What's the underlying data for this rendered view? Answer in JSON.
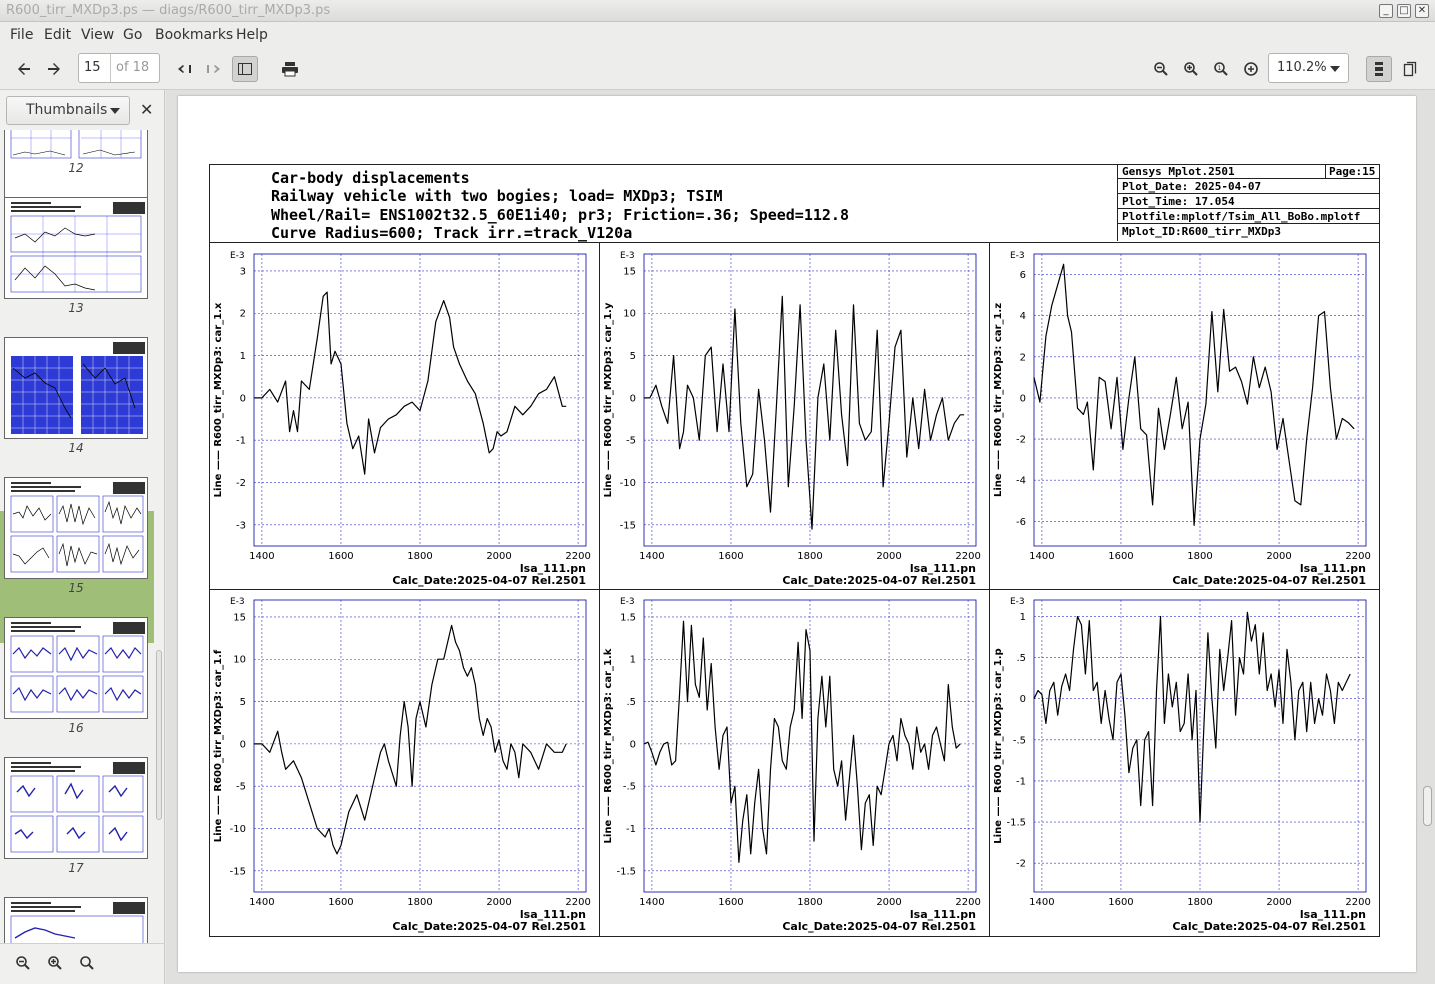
{
  "window": {
    "title": "R600_tirr_MXDp3.ps — diags/R600_tirr_MXDp3.ps"
  },
  "menu": [
    "File",
    "Edit",
    "View",
    "Go",
    "Bookmarks",
    "Help"
  ],
  "toolbar": {
    "page_current": "15",
    "page_total": "of 18",
    "zoom": "110.2%"
  },
  "sidebar": {
    "mode": "Thumbnails",
    "thumbnails": [
      "12",
      "13",
      "14",
      "15",
      "16",
      "17"
    ],
    "selected": "15"
  },
  "document": {
    "header_lines": [
      "Car-body displacements",
      "Railway vehicle with two bogies; load= MXDp3; TSIM",
      "Wheel/Rail= ENS1002t32.5_60E1i40; pr3; Friction=.36; Speed=112.8",
      "Curve Radius=600; Track irr.=track_V120a"
    ],
    "info": {
      "program": "Gensys Mplot.2501",
      "page": "Page:15",
      "plot_date": "Plot_Date: 2025-04-07",
      "plot_time": "Plot_Time: 17.054",
      "plotfile": "Plotfile:mplotf/Tsim_All_BoBo.mplotf",
      "mplot_id": "Mplot_ID:R600_tirr_MXDp3"
    },
    "panel_footer_1": "lsa_111.pn",
    "panel_footer_2": "Calc_Date:2025-04-07 Rel.2501"
  },
  "chart_data": [
    {
      "type": "line",
      "ylabel": "Line —— R600_tirr_MXDp3: car_1.x",
      "yscale_label": "E-3",
      "xlim": [
        1380,
        2220
      ],
      "ylim": [
        -3.5,
        3.4
      ],
      "xticks": [
        1400,
        1600,
        1800,
        2000,
        2200
      ],
      "yticks": [
        -3,
        -2,
        -1,
        0,
        1,
        2,
        3
      ],
      "ytick_labels": [
        "-3",
        "-2",
        "-1",
        "0",
        "1",
        "2",
        "3"
      ],
      "series": [
        {
          "x": [
            1380,
            1400,
            1420,
            1440,
            1460,
            1470,
            1480,
            1490,
            1500,
            1520,
            1540,
            1555,
            1565,
            1575,
            1585,
            1600,
            1615,
            1630,
            1645,
            1660,
            1670,
            1685,
            1700,
            1720,
            1740,
            1760,
            1780,
            1800,
            1820,
            1840,
            1860,
            1875,
            1885,
            1900,
            1920,
            1940,
            1960,
            1975,
            1985,
            1995,
            2005,
            2020,
            2040,
            2060,
            2080,
            2100,
            2120,
            2140,
            2160,
            2170
          ],
          "y": [
            0,
            0,
            0.2,
            -0.1,
            0.4,
            -0.8,
            -0.3,
            -0.8,
            0.4,
            0.2,
            1.4,
            2.4,
            2.5,
            0.8,
            1.1,
            0.8,
            -0.6,
            -1.2,
            -0.9,
            -1.8,
            -0.5,
            -1.3,
            -0.7,
            -0.5,
            -0.4,
            -0.2,
            -0.1,
            -0.3,
            0.4,
            1.8,
            2.3,
            1.9,
            1.2,
            0.8,
            0.4,
            0.1,
            -0.6,
            -1.3,
            -1.2,
            -0.8,
            -0.9,
            -0.8,
            -0.2,
            -0.4,
            -0.2,
            0.1,
            0.2,
            0.5,
            -0.2,
            -0.2
          ]
        }
      ]
    },
    {
      "type": "line",
      "ylabel": "Line —— R600_tirr_MXDp3: car_1.y",
      "yscale_label": "E-3",
      "xlim": [
        1380,
        2220
      ],
      "ylim": [
        -17.5,
        17
      ],
      "xticks": [
        1400,
        1600,
        1800,
        2000,
        2200
      ],
      "yticks": [
        -15,
        -10,
        -5,
        0,
        5,
        10,
        15
      ],
      "ytick_labels": [
        "-15",
        "-10",
        "-5",
        "0",
        "5",
        "10",
        "15"
      ],
      "series": [
        {
          "x": [
            1380,
            1395,
            1410,
            1425,
            1440,
            1455,
            1470,
            1480,
            1490,
            1505,
            1520,
            1535,
            1550,
            1565,
            1580,
            1595,
            1610,
            1625,
            1640,
            1655,
            1670,
            1685,
            1700,
            1715,
            1730,
            1745,
            1760,
            1775,
            1790,
            1805,
            1820,
            1835,
            1850,
            1865,
            1880,
            1895,
            1910,
            1925,
            1940,
            1955,
            1970,
            1985,
            2000,
            2015,
            2030,
            2045,
            2060,
            2075,
            2090,
            2105,
            2120,
            2135,
            2150,
            2165,
            2180,
            2190
          ],
          "y": [
            0,
            0,
            1.5,
            -1,
            -3,
            5,
            -6,
            -4,
            1.5,
            0,
            -5,
            5,
            6,
            -4,
            4,
            -4,
            10.5,
            -3,
            -10.5,
            -9,
            1,
            -5,
            -13.5,
            -1,
            12,
            -10.5,
            -1,
            11,
            -5,
            -15.5,
            0,
            4,
            -5,
            8,
            -2,
            -8,
            11,
            -3,
            -5,
            -4,
            8,
            -10.5,
            -3,
            6,
            8,
            -7,
            0,
            -6,
            1,
            -5,
            -2,
            0,
            -5,
            -3,
            -2,
            -2
          ]
        }
      ]
    },
    {
      "type": "line",
      "ylabel": "Line —— R600_tirr_MXDp3: car_1.z",
      "yscale_label": "E-3",
      "xlim": [
        1380,
        2220
      ],
      "ylim": [
        -7.2,
        7
      ],
      "xticks": [
        1400,
        1600,
        1800,
        2000,
        2200
      ],
      "yticks": [
        -6,
        -4,
        -2,
        0,
        2,
        4,
        6
      ],
      "ytick_labels": [
        "-6",
        "-4",
        "-2",
        "0",
        "2",
        "4",
        "6"
      ],
      "series": [
        {
          "x": [
            1380,
            1395,
            1410,
            1425,
            1440,
            1455,
            1465,
            1475,
            1490,
            1505,
            1515,
            1530,
            1545,
            1560,
            1575,
            1590,
            1605,
            1620,
            1635,
            1650,
            1665,
            1680,
            1695,
            1710,
            1725,
            1740,
            1755,
            1770,
            1785,
            1800,
            1815,
            1830,
            1845,
            1860,
            1875,
            1890,
            1905,
            1920,
            1935,
            1950,
            1965,
            1980,
            1995,
            2010,
            2025,
            2040,
            2055,
            2070,
            2085,
            2100,
            2115,
            2130,
            2145,
            2160,
            2175,
            2190
          ],
          "y": [
            1,
            -0.2,
            3,
            4.5,
            5.5,
            6.5,
            4,
            3.2,
            -0.5,
            -0.8,
            -0.2,
            -3.5,
            1,
            0.8,
            -1.5,
            1,
            -2.5,
            0,
            2,
            -1.5,
            -1.8,
            -5.2,
            -0.5,
            -2.5,
            -0.8,
            1,
            -1.5,
            -0.2,
            -6.2,
            -2,
            -0.3,
            4.2,
            0.3,
            4.3,
            1.3,
            1.5,
            0.8,
            -0.3,
            2,
            0.5,
            1.5,
            0.3,
            -2.5,
            -1,
            -3,
            -5,
            -5.2,
            -2,
            0.5,
            4,
            4.2,
            0.5,
            -2,
            -1,
            -1.2,
            -1.5
          ]
        }
      ]
    },
    {
      "type": "line",
      "ylabel": "Line —— R600_tirr_MXDp3: car_1.f",
      "yscale_label": "E-3",
      "xlim": [
        1380,
        2220
      ],
      "ylim": [
        -17.5,
        17
      ],
      "xticks": [
        1400,
        1600,
        1800,
        2000,
        2200
      ],
      "yticks": [
        -15,
        -10,
        -5,
        0,
        5,
        10,
        15
      ],
      "ytick_labels": [
        "-15",
        "-10",
        "-5",
        "0",
        "5",
        "10",
        "15"
      ],
      "series": [
        {
          "x": [
            1380,
            1400,
            1420,
            1440,
            1450,
            1460,
            1480,
            1500,
            1520,
            1540,
            1560,
            1570,
            1580,
            1590,
            1600,
            1610,
            1620,
            1640,
            1660,
            1680,
            1690,
            1700,
            1710,
            1720,
            1740,
            1750,
            1760,
            1770,
            1780,
            1790,
            1800,
            1815,
            1830,
            1845,
            1860,
            1875,
            1880,
            1890,
            1900,
            1910,
            1920,
            1930,
            1940,
            1950,
            1960,
            1970,
            1980,
            1990,
            2000,
            2010,
            2020,
            2030,
            2040,
            2050,
            2060,
            2080,
            2100,
            2120,
            2140,
            2160,
            2170
          ],
          "y": [
            0,
            0,
            -1,
            1.5,
            -1,
            -3,
            -2,
            -4,
            -7,
            -10,
            -11,
            -10,
            -12,
            -13,
            -12,
            -10,
            -8,
            -6,
            -9,
            -5,
            -3,
            -1,
            0,
            -2,
            -5,
            1,
            5,
            2,
            -5,
            3,
            5,
            2,
            7,
            10,
            10,
            13,
            14,
            12,
            11,
            9,
            8,
            9,
            7,
            3,
            1,
            3,
            2,
            -1,
            0.5,
            -2,
            -3,
            0,
            -1,
            -4,
            0,
            -1,
            -3,
            0,
            -1,
            -1,
            0
          ]
        }
      ]
    },
    {
      "type": "line",
      "ylabel": "Line —— R600_tirr_MXDp3: car_1.k",
      "yscale_label": "E-3",
      "xlim": [
        1380,
        2220
      ],
      "ylim": [
        -1.75,
        1.7
      ],
      "xticks": [
        1400,
        1600,
        1800,
        2000,
        2200
      ],
      "yticks": [
        -1.5,
        -1,
        -0.5,
        0,
        0.5,
        1,
        1.5
      ],
      "ytick_labels": [
        "-1.5",
        "-1",
        "-.5",
        "0",
        ".5",
        "1",
        "1.5"
      ],
      "series": [
        {
          "x": [
            1380,
            1390,
            1400,
            1410,
            1420,
            1430,
            1440,
            1450,
            1460,
            1470,
            1480,
            1490,
            1500,
            1510,
            1520,
            1530,
            1540,
            1550,
            1560,
            1570,
            1580,
            1590,
            1600,
            1610,
            1620,
            1630,
            1640,
            1650,
            1660,
            1670,
            1680,
            1690,
            1700,
            1710,
            1720,
            1730,
            1740,
            1750,
            1760,
            1770,
            1780,
            1790,
            1800,
            1810,
            1820,
            1830,
            1840,
            1850,
            1860,
            1870,
            1880,
            1890,
            1900,
            1910,
            1920,
            1930,
            1940,
            1950,
            1960,
            1970,
            1980,
            1990,
            2000,
            2010,
            2020,
            2030,
            2040,
            2050,
            2060,
            2070,
            2080,
            2090,
            2100,
            2110,
            2120,
            2130,
            2140,
            2150,
            2160,
            2170,
            2180
          ],
          "y": [
            0,
            0.02,
            -0.1,
            -0.25,
            -0.1,
            0,
            0.02,
            -0.25,
            -0.2,
            0.6,
            1.45,
            0.5,
            1.4,
            0.7,
            0.55,
            1.25,
            0.4,
            0.95,
            0.2,
            -0.3,
            0.1,
            0.2,
            -0.7,
            -0.5,
            -1.4,
            -0.9,
            -0.6,
            -1.3,
            -0.7,
            -0.3,
            -1,
            -1.3,
            -0.3,
            0.3,
            0.2,
            -0.2,
            -0.3,
            0.2,
            0.4,
            1.2,
            0.3,
            1.35,
            1.1,
            -1.15,
            0.3,
            0.8,
            0.2,
            0.8,
            -0.3,
            -0.5,
            -0.2,
            -0.9,
            -0.4,
            0.1,
            -0.5,
            -1.25,
            -0.7,
            -0.6,
            -1.2,
            -0.5,
            -0.6,
            -0.3,
            0,
            0.1,
            -0.2,
            0.3,
            0.1,
            0,
            -0.3,
            0.2,
            -0.1,
            0,
            -0.3,
            0.1,
            0.2,
            0,
            -0.2,
            0.7,
            0.2,
            -0.05,
            0
          ]
        }
      ]
    },
    {
      "type": "line",
      "ylabel": "Line —— R600_tirr_MXDp3: car_1.p",
      "yscale_label": "E-3",
      "xlim": [
        1380,
        2220
      ],
      "ylim": [
        -2.35,
        1.2
      ],
      "xticks": [
        1400,
        1600,
        1800,
        2000,
        2200
      ],
      "yticks": [
        -2,
        -1.5,
        -1,
        -0.5,
        0,
        0.5,
        1
      ],
      "ytick_labels": [
        "-2",
        "-1.5",
        "-1",
        "-.5",
        "0",
        ".5",
        "1"
      ],
      "series": [
        {
          "x": [
            1380,
            1390,
            1400,
            1410,
            1420,
            1430,
            1440,
            1450,
            1460,
            1470,
            1480,
            1490,
            1500,
            1510,
            1520,
            1530,
            1540,
            1550,
            1560,
            1570,
            1580,
            1590,
            1600,
            1610,
            1620,
            1630,
            1640,
            1650,
            1660,
            1670,
            1680,
            1690,
            1700,
            1710,
            1720,
            1730,
            1740,
            1750,
            1760,
            1770,
            1780,
            1790,
            1800,
            1810,
            1820,
            1830,
            1840,
            1850,
            1860,
            1870,
            1880,
            1890,
            1900,
            1910,
            1920,
            1930,
            1940,
            1950,
            1960,
            1970,
            1980,
            1990,
            2000,
            2010,
            2020,
            2030,
            2040,
            2050,
            2060,
            2070,
            2080,
            2090,
            2100,
            2110,
            2120,
            2130,
            2140,
            2150,
            2160,
            2170,
            2180
          ],
          "y": [
            0,
            0.1,
            0.05,
            -0.3,
            0.1,
            0.2,
            -0.2,
            0.15,
            0.3,
            0.1,
            0.6,
            1,
            0.9,
            0.3,
            0.95,
            0.1,
            0.2,
            -0.3,
            0.1,
            -0.25,
            -0.5,
            0.2,
            0.3,
            -0.2,
            -0.9,
            -0.6,
            -0.5,
            -1.3,
            -0.5,
            -0.4,
            -1.3,
            0.1,
            1,
            -0.3,
            0.3,
            -0.1,
            0.2,
            -0.4,
            -0.3,
            0.3,
            -0.5,
            0.1,
            -1.5,
            -0.3,
            0.8,
            0,
            -0.6,
            0.6,
            0.1,
            0.5,
            0.95,
            -0.2,
            0.5,
            0.3,
            1.05,
            0.7,
            0.9,
            0.3,
            0.8,
            0.1,
            0.3,
            -0.1,
            0.35,
            -0.3,
            0.6,
            0.2,
            -0.5,
            0.1,
            0.2,
            -0.4,
            0.2,
            -0.3,
            0,
            -0.2,
            0.3,
            0.1,
            -0.3,
            0.2,
            0.1,
            0.2,
            0.3
          ]
        }
      ]
    }
  ]
}
